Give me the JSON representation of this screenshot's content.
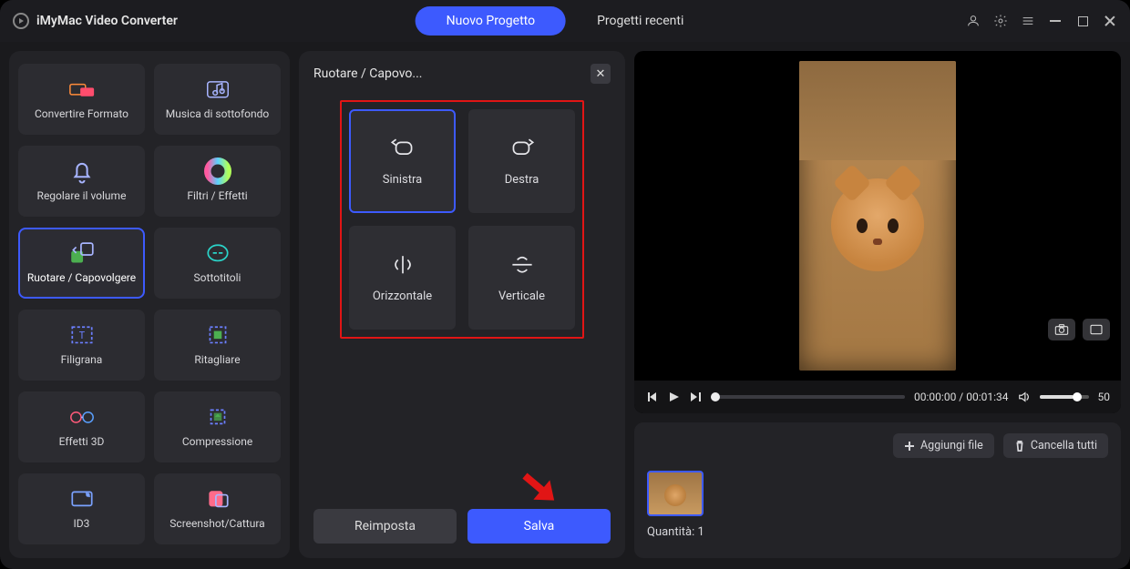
{
  "app": {
    "title": "iMyMac Video Converter"
  },
  "tabs": {
    "new": "Nuovo Progetto",
    "recent": "Progetti recenti"
  },
  "sidebar": {
    "items": [
      {
        "label": "Convertire Formato"
      },
      {
        "label": "Musica di sottofondo"
      },
      {
        "label": "Regolare il volume"
      },
      {
        "label": "Filtri / Effetti"
      },
      {
        "label": "Ruotare / Capovolgere"
      },
      {
        "label": "Sottotitoli"
      },
      {
        "label": "Filigrana"
      },
      {
        "label": "Ritagliare"
      },
      {
        "label": "Effetti 3D"
      },
      {
        "label": "Compressione"
      },
      {
        "label": "ID3"
      },
      {
        "label": "Screenshot/Cattura"
      }
    ]
  },
  "panel": {
    "title": "Ruotare / Capovo...",
    "options": {
      "left": "Sinistra",
      "right": "Destra",
      "horizontal": "Orizzontale",
      "vertical": "Verticale"
    },
    "reset": "Reimposta",
    "save": "Salva"
  },
  "player": {
    "current": "00:00:00",
    "total": "00:01:34",
    "volume": "50"
  },
  "files": {
    "add": "Aggiungi file",
    "clear": "Cancella tutti",
    "qty_label": "Quantità:",
    "qty_value": "1"
  }
}
